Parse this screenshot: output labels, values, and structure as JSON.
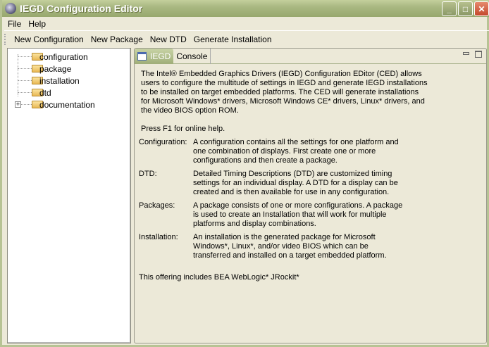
{
  "window": {
    "title": "IEGD Configuration Editor",
    "minimize": "_",
    "maximize": "□",
    "close": "✕"
  },
  "menu": [
    "File",
    "Help"
  ],
  "toolbar": [
    "New Configuration",
    "New Package",
    "New DTD",
    "Generate Installation"
  ],
  "tree": [
    {
      "label": "configuration"
    },
    {
      "label": "package"
    },
    {
      "label": "installation"
    },
    {
      "label": "dtd"
    },
    {
      "label": "documentation",
      "expander": "+"
    }
  ],
  "tabs": [
    {
      "label": "IEGD"
    },
    {
      "label": "Console"
    }
  ],
  "content": {
    "intro": "The Intel® Embedded Graphics Drivers (IEGD) Configuration EDitor (CED) allows users to configure the multitude of settings in IEGD and generate IEGD installations to be installed on target embedded platforms.  The CED will generate installations for Microsoft Windows* drivers, Microsoft Windows CE* drivers, Linux* drivers, and the video BIOS option ROM.",
    "help": "Press F1 for online help.",
    "definitions": [
      {
        "term": "Configuration:",
        "text": "A configuration contains all the settings for one platform and one combination of displays.  First create one or more configurations and then create a package."
      },
      {
        "term": "DTD:",
        "text": "Detailed Timing Descriptions (DTD) are customized timing settings for an individual display.  A DTD for a display can be created and is then available for use in any configuration."
      },
      {
        "term": "Packages:",
        "text": "A package consists of one or more configurations.  A package is used to create an Installation that will work for multiple platforms and display combinations."
      },
      {
        "term": "Installation:",
        "text": "An installation is the generated package for Microsoft Windows*, Linux*, and/or video BIOS which can be transferred and installed on a target embedded platform."
      }
    ],
    "footer": "This offering includes BEA WebLogic* JRockit*"
  }
}
